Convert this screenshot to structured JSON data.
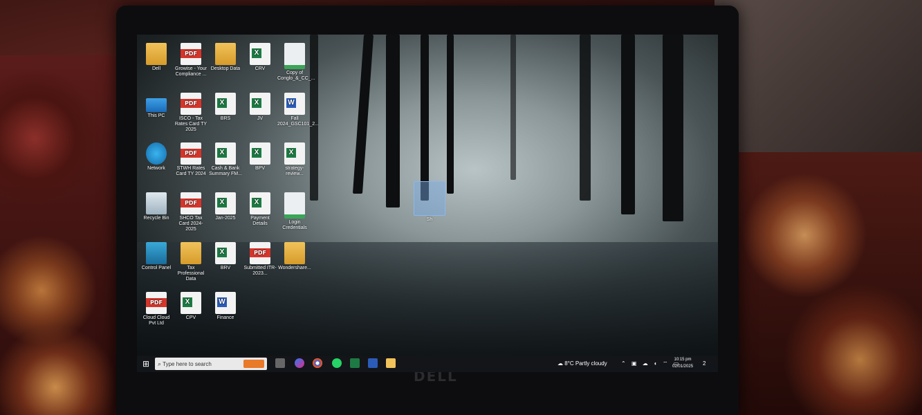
{
  "desktop": {
    "icons": [
      {
        "label": "Dell",
        "type": "folder-user"
      },
      {
        "label": "Growise - Your Compliance ...",
        "type": "pdf"
      },
      {
        "label": "Desktop Data",
        "type": "folder"
      },
      {
        "label": "CRV",
        "type": "excel"
      },
      {
        "label": "Copy of Conglo_&_CC_...",
        "type": "image"
      },
      {
        "label": "This PC",
        "type": "pc"
      },
      {
        "label": "ISCO - Tax Rates Card TY 2025",
        "type": "pdf"
      },
      {
        "label": "BRS",
        "type": "excel"
      },
      {
        "label": "JV",
        "type": "excel"
      },
      {
        "label": "Fall 2024_GSC101_2...",
        "type": "word"
      },
      {
        "label": "Network",
        "type": "network"
      },
      {
        "label": "STWH Rates Card TY 2024",
        "type": "pdf"
      },
      {
        "label": "Cash & Bank Summary FM...",
        "type": "excel"
      },
      {
        "label": "BPV",
        "type": "excel"
      },
      {
        "label": "strategy-review...",
        "type": "excel"
      },
      {
        "label": "Recycle Bin",
        "type": "recycle-bin"
      },
      {
        "label": "SHCO Tax Card 2024-2025",
        "type": "pdf"
      },
      {
        "label": "Jan-2025",
        "type": "excel"
      },
      {
        "label": "Payment Details",
        "type": "excel"
      },
      {
        "label": "Login Credentials",
        "type": "image"
      },
      {
        "label": "Control Panel",
        "type": "control-panel"
      },
      {
        "label": "Tax Professional Data",
        "type": "folder"
      },
      {
        "label": "BRV",
        "type": "excel"
      },
      {
        "label": "Submitted ITR-2023...",
        "type": "pdf"
      },
      {
        "label": "Wondershare...",
        "type": "folder"
      },
      {
        "label": "Cloud Cloud Pvt Ltd",
        "type": "pdf"
      },
      {
        "label": "CPV",
        "type": "excel"
      },
      {
        "label": "Finance",
        "type": "word"
      }
    ],
    "dragged_icon": {
      "label": "Sh",
      "type": "image"
    }
  },
  "taskbar": {
    "search_placeholder": "Type here to search",
    "weather": "8°C  Partly cloudy",
    "time": "10:15 pm",
    "date": "02/01/2025",
    "notification_count": "2"
  },
  "laptop": {
    "brand": "DELL"
  }
}
